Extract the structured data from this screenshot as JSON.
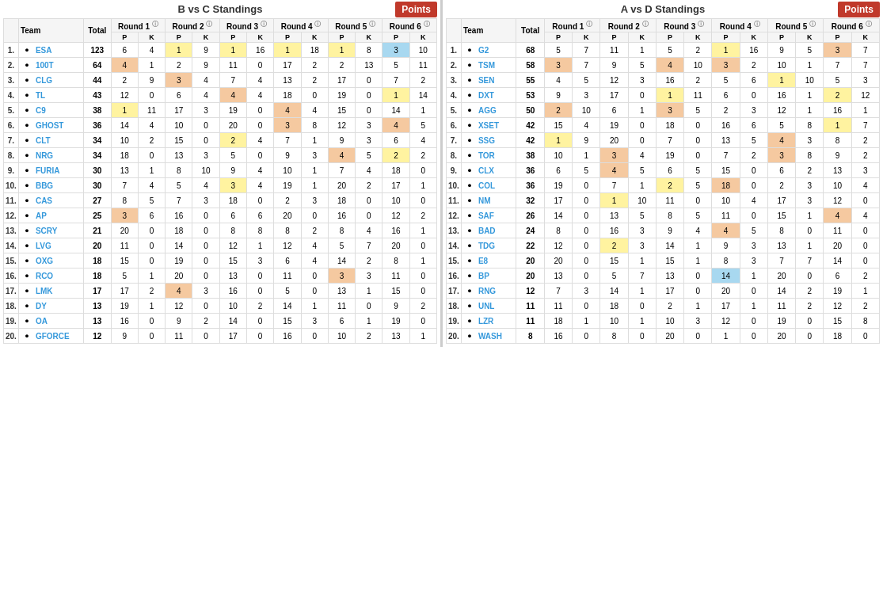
{
  "leftPanel": {
    "title": "B vs C Standings",
    "pointsButton": "Points",
    "columns": [
      "Team",
      "Total",
      "Round 1",
      "Round 2",
      "Round 3",
      "Round 4",
      "Round 5",
      "Round 6"
    ],
    "subCols": [
      "P",
      "K"
    ],
    "teams": [
      {
        "rank": 1,
        "icon": "ESA",
        "name": "ESA",
        "total": 123,
        "r1p": 6,
        "r1k": 4,
        "r2p": 1,
        "r2k": 9,
        "r3p": 1,
        "r3k": 16,
        "r4p": 1,
        "r4k": 18,
        "r5p": 1,
        "r5k": 8,
        "r6p": 3,
        "r6k": 10,
        "r2ph": true,
        "r3ph": true,
        "r4ph": true,
        "r5ph": true,
        "r6bh": true
      },
      {
        "rank": 2,
        "icon": "100T",
        "name": "100T",
        "total": 64,
        "r1p": 4,
        "r1k": 1,
        "r2p": 2,
        "r2k": 9,
        "r3p": 11,
        "r3k": 0,
        "r4p": 17,
        "r4k": 2,
        "r5p": 2,
        "r5k": 13,
        "r6p": 5,
        "r6k": 11,
        "r1oh": true
      },
      {
        "rank": 3,
        "icon": "CLG",
        "name": "CLG",
        "total": 44,
        "r1p": 2,
        "r1k": 9,
        "r2p": 3,
        "r2k": 4,
        "r3p": 7,
        "r3k": 4,
        "r4p": 13,
        "r4k": 2,
        "r5p": 17,
        "r5k": 0,
        "r6p": 7,
        "r6k": 2,
        "r2oh": true
      },
      {
        "rank": 4,
        "icon": "TL",
        "name": "TL",
        "total": 43,
        "r1p": 12,
        "r1k": 0,
        "r2p": 6,
        "r2k": 4,
        "r3p": 4,
        "r3k": 4,
        "r4p": 18,
        "r4k": 0,
        "r5p": 19,
        "r5k": 0,
        "r6p": 1,
        "r6k": 14,
        "r3oh": true,
        "r6ph": true
      },
      {
        "rank": 5,
        "icon": "C9",
        "name": "C9",
        "total": 38,
        "r1p": 1,
        "r1k": 11,
        "r2p": 17,
        "r2k": 3,
        "r3p": 19,
        "r3k": 0,
        "r4p": 4,
        "r4k": 4,
        "r5p": 15,
        "r5k": 0,
        "r6p": 14,
        "r6k": 1,
        "r1ph": true,
        "r4oh": true
      },
      {
        "rank": 6,
        "icon": "GHOST",
        "name": "GHOST",
        "total": 36,
        "r1p": 14,
        "r1k": 4,
        "r2p": 10,
        "r2k": 0,
        "r3p": 20,
        "r3k": 0,
        "r4p": 3,
        "r4k": 8,
        "r5p": 12,
        "r5k": 3,
        "r6p": 4,
        "r6k": 5,
        "r4oh": true,
        "r6oh": true
      },
      {
        "rank": 7,
        "icon": "CLT",
        "name": "CLT",
        "total": 34,
        "r1p": 10,
        "r1k": 2,
        "r2p": 15,
        "r2k": 0,
        "r3p": 2,
        "r3k": 4,
        "r4p": 7,
        "r4k": 1,
        "r5p": 9,
        "r5k": 3,
        "r6p": 6,
        "r6k": 4,
        "r3ph": true
      },
      {
        "rank": 8,
        "icon": "NRG",
        "name": "NRG",
        "total": 34,
        "r1p": 18,
        "r1k": 0,
        "r2p": 13,
        "r2k": 3,
        "r3p": 5,
        "r3k": 0,
        "r4p": 9,
        "r4k": 3,
        "r5p": 4,
        "r5k": 5,
        "r6p": 2,
        "r6k": 2,
        "r5oh": true,
        "r6ph": true
      },
      {
        "rank": 9,
        "icon": "FURIA",
        "name": "FURIA",
        "total": 30,
        "r1p": 13,
        "r1k": 1,
        "r2p": 8,
        "r2k": 10,
        "r3p": 9,
        "r3k": 4,
        "r4p": 10,
        "r4k": 1,
        "r5p": 7,
        "r5k": 4,
        "r6p": 18,
        "r6k": 0
      },
      {
        "rank": 10,
        "icon": "BBG",
        "name": "BBG",
        "total": 30,
        "r1p": 7,
        "r1k": 4,
        "r2p": 5,
        "r2k": 4,
        "r3p": 3,
        "r3k": 4,
        "r4p": 19,
        "r4k": 1,
        "r5p": 20,
        "r5k": 2,
        "r6p": 17,
        "r6k": 1,
        "r3ph": true
      },
      {
        "rank": 11,
        "icon": "CAS",
        "name": "CAS",
        "total": 27,
        "r1p": 8,
        "r1k": 5,
        "r2p": 7,
        "r2k": 3,
        "r3p": 18,
        "r3k": 0,
        "r4p": 2,
        "r4k": 3,
        "r5p": 18,
        "r5k": 0,
        "r6p": 10,
        "r6k": 0
      },
      {
        "rank": 12,
        "icon": "AP",
        "name": "AP",
        "total": 25,
        "r1p": 3,
        "r1k": 6,
        "r2p": 16,
        "r2k": 0,
        "r3p": 6,
        "r3k": 6,
        "r4p": 20,
        "r4k": 0,
        "r5p": 16,
        "r5k": 0,
        "r6p": 12,
        "r6k": 2,
        "r1oh": true
      },
      {
        "rank": 13,
        "icon": "SCRY",
        "name": "SCRY",
        "total": 21,
        "r1p": 20,
        "r1k": 0,
        "r2p": 18,
        "r2k": 0,
        "r3p": 8,
        "r3k": 8,
        "r4p": 8,
        "r4k": 2,
        "r5p": 8,
        "r5k": 4,
        "r6p": 16,
        "r6k": 1
      },
      {
        "rank": 14,
        "icon": "LVG",
        "name": "LVG",
        "total": 20,
        "r1p": 11,
        "r1k": 0,
        "r2p": 14,
        "r2k": 0,
        "r3p": 12,
        "r3k": 1,
        "r4p": 12,
        "r4k": 4,
        "r5p": 5,
        "r5k": 7,
        "r6p": 20,
        "r6k": 0
      },
      {
        "rank": 15,
        "icon": "OXG",
        "name": "OXG",
        "total": 18,
        "r1p": 15,
        "r1k": 0,
        "r2p": 19,
        "r2k": 0,
        "r3p": 15,
        "r3k": 3,
        "r4p": 6,
        "r4k": 4,
        "r5p": 14,
        "r5k": 2,
        "r6p": 8,
        "r6k": 1
      },
      {
        "rank": 16,
        "icon": "RCO",
        "name": "RCO",
        "total": 18,
        "r1p": 5,
        "r1k": 1,
        "r2p": 20,
        "r2k": 0,
        "r3p": 13,
        "r3k": 0,
        "r4p": 11,
        "r4k": 0,
        "r5p": 3,
        "r5k": 3,
        "r6p": 11,
        "r6k": 0,
        "r5oh": true
      },
      {
        "rank": 17,
        "icon": "LMK",
        "name": "LMK",
        "total": 17,
        "r1p": 17,
        "r1k": 2,
        "r2p": 4,
        "r2k": 3,
        "r3p": 16,
        "r3k": 0,
        "r4p": 5,
        "r4k": 0,
        "r5p": 13,
        "r5k": 1,
        "r6p": 15,
        "r6k": 0,
        "r2oh": true
      },
      {
        "rank": 18,
        "icon": "DY",
        "name": "DY",
        "total": 13,
        "r1p": 19,
        "r1k": 1,
        "r2p": 12,
        "r2k": 0,
        "r3p": 10,
        "r3k": 2,
        "r4p": 14,
        "r4k": 1,
        "r5p": 11,
        "r5k": 0,
        "r6p": 9,
        "r6k": 2
      },
      {
        "rank": 19,
        "icon": "OA",
        "name": "OA",
        "total": 13,
        "r1p": 16,
        "r1k": 0,
        "r2p": 9,
        "r2k": 2,
        "r3p": 14,
        "r3k": 0,
        "r4p": 15,
        "r4k": 3,
        "r5p": 6,
        "r5k": 1,
        "r6p": 19,
        "r6k": 0
      },
      {
        "rank": 20,
        "icon": "GFORCE",
        "name": "GFORCE",
        "total": 12,
        "r1p": 9,
        "r1k": 0,
        "r2p": 11,
        "r2k": 0,
        "r3p": 17,
        "r3k": 0,
        "r4p": 16,
        "r4k": 0,
        "r5p": 10,
        "r5k": 2,
        "r6p": 13,
        "r6k": 1
      }
    ]
  },
  "rightPanel": {
    "title": "A vs D Standings",
    "pointsButton": "Points",
    "columns": [
      "Team",
      "Total",
      "Round 1",
      "Round 2",
      "Round 3",
      "Round 4",
      "Round 5",
      "Round 6"
    ],
    "subCols": [
      "P",
      "K"
    ],
    "teams": [
      {
        "rank": 1,
        "icon": "G2",
        "name": "G2",
        "total": 68,
        "r1p": 5,
        "r1k": 7,
        "r2p": 11,
        "r2k": 1,
        "r3p": 5,
        "r3k": 2,
        "r4p": 1,
        "r4k": 16,
        "r5p": 9,
        "r5k": 5,
        "r6p": 3,
        "r6k": 7,
        "r4ph": true,
        "r6oh": true
      },
      {
        "rank": 2,
        "icon": "TSM",
        "name": "TSM",
        "total": 58,
        "r1p": 3,
        "r1k": 7,
        "r2p": 9,
        "r2k": 5,
        "r3p": 4,
        "r3k": 10,
        "r4p": 3,
        "r4k": 2,
        "r5p": 10,
        "r5k": 1,
        "r6p": 7,
        "r6k": 7,
        "r1oh": true,
        "r3oh": true,
        "r4oh": true
      },
      {
        "rank": 3,
        "icon": "SEN",
        "name": "SEN",
        "total": 55,
        "r1p": 4,
        "r1k": 5,
        "r2p": 12,
        "r2k": 3,
        "r3p": 16,
        "r3k": 2,
        "r4p": 5,
        "r4k": 6,
        "r5p": 1,
        "r5k": 10,
        "r6p": 5,
        "r6k": 3,
        "r5ph": true
      },
      {
        "rank": 4,
        "icon": "DXT",
        "name": "DXT",
        "total": 53,
        "r1p": 9,
        "r1k": 3,
        "r2p": 17,
        "r2k": 0,
        "r3p": 1,
        "r3k": 11,
        "r4p": 6,
        "r4k": 0,
        "r5p": 16,
        "r5k": 1,
        "r6p": 2,
        "r6k": 12,
        "r3ph": true,
        "r6ph": true
      },
      {
        "rank": 5,
        "icon": "AGG",
        "name": "AGG",
        "total": 50,
        "r1p": 2,
        "r1k": 10,
        "r2p": 6,
        "r2k": 1,
        "r3p": 3,
        "r3k": 5,
        "r4p": 2,
        "r4k": 3,
        "r5p": 12,
        "r5k": 1,
        "r6p": 16,
        "r6k": 1,
        "r1oh": true,
        "r3oh": true
      },
      {
        "rank": 6,
        "icon": "XSET",
        "name": "XSET",
        "total": 42,
        "r1p": 15,
        "r1k": 4,
        "r2p": 19,
        "r2k": 0,
        "r3p": 18,
        "r3k": 0,
        "r4p": 16,
        "r4k": 6,
        "r5p": 5,
        "r5k": 8,
        "r6p": 1,
        "r6k": 7,
        "r6ph": true
      },
      {
        "rank": 7,
        "icon": "SSG",
        "name": "SSG",
        "total": 42,
        "r1p": 1,
        "r1k": 9,
        "r2p": 20,
        "r2k": 0,
        "r3p": 7,
        "r3k": 0,
        "r4p": 13,
        "r4k": 5,
        "r5p": 4,
        "r5k": 3,
        "r6p": 8,
        "r6k": 2,
        "r1ph": true,
        "r5oh": true
      },
      {
        "rank": 8,
        "icon": "TOR",
        "name": "TOR",
        "total": 38,
        "r1p": 10,
        "r1k": 1,
        "r2p": 3,
        "r2k": 4,
        "r3p": 19,
        "r3k": 0,
        "r4p": 7,
        "r4k": 2,
        "r5p": 3,
        "r5k": 8,
        "r6p": 9,
        "r6k": 2,
        "r2oh": true,
        "r5oh": true
      },
      {
        "rank": 9,
        "icon": "CLX",
        "name": "CLX",
        "total": 36,
        "r1p": 6,
        "r1k": 5,
        "r2p": 4,
        "r2k": 5,
        "r3p": 6,
        "r3k": 5,
        "r4p": 15,
        "r4k": 0,
        "r5p": 6,
        "r5k": 2,
        "r6p": 13,
        "r6k": 3,
        "r2oh": true
      },
      {
        "rank": 10,
        "icon": "COL",
        "name": "COL",
        "total": 36,
        "r1p": 19,
        "r1k": 0,
        "r2p": 7,
        "r2k": 1,
        "r3p": 2,
        "r3k": 5,
        "r4p": 18,
        "r4k": 0,
        "r5p": 2,
        "r5k": 3,
        "r6p": 10,
        "r6k": 4,
        "r3ph": true,
        "r4oh": true
      },
      {
        "rank": 11,
        "icon": "NM",
        "name": "NM",
        "total": 32,
        "r1p": 17,
        "r1k": 0,
        "r2p": 1,
        "r2k": 10,
        "r3p": 11,
        "r3k": 0,
        "r4p": 10,
        "r4k": 4,
        "r5p": 17,
        "r5k": 3,
        "r6p": 12,
        "r6k": 0,
        "r2ph": true
      },
      {
        "rank": 12,
        "icon": "SAF",
        "name": "SAF",
        "total": 26,
        "r1p": 14,
        "r1k": 0,
        "r2p": 13,
        "r2k": 5,
        "r3p": 8,
        "r3k": 5,
        "r4p": 11,
        "r4k": 0,
        "r5p": 15,
        "r5k": 1,
        "r6p": 4,
        "r6k": 4,
        "r6oh": true
      },
      {
        "rank": 13,
        "icon": "BAD",
        "name": "BAD",
        "total": 24,
        "r1p": 8,
        "r1k": 0,
        "r2p": 16,
        "r2k": 3,
        "r3p": 9,
        "r3k": 4,
        "r4p": 4,
        "r4k": 5,
        "r5p": 8,
        "r5k": 0,
        "r6p": 11,
        "r6k": 0,
        "r4oh": true
      },
      {
        "rank": 14,
        "icon": "TDG",
        "name": "TDG",
        "total": 22,
        "r1p": 12,
        "r1k": 0,
        "r2p": 2,
        "r2k": 3,
        "r3p": 14,
        "r3k": 1,
        "r4p": 9,
        "r4k": 3,
        "r5p": 13,
        "r5k": 1,
        "r6p": 20,
        "r6k": 0,
        "r2ph": true
      },
      {
        "rank": 15,
        "icon": "E8",
        "name": "E8",
        "total": 20,
        "r1p": 20,
        "r1k": 0,
        "r2p": 15,
        "r2k": 1,
        "r3p": 15,
        "r3k": 1,
        "r4p": 8,
        "r4k": 3,
        "r5p": 7,
        "r5k": 7,
        "r6p": 14,
        "r6k": 0
      },
      {
        "rank": 16,
        "icon": "BP",
        "name": "BP",
        "total": 20,
        "r1p": 13,
        "r1k": 0,
        "r2p": 5,
        "r2k": 7,
        "r3p": 13,
        "r3k": 0,
        "r4p": 14,
        "r4k": 1,
        "r5p": 20,
        "r5k": 0,
        "r6p": 6,
        "r6k": 2,
        "r4bh": true
      },
      {
        "rank": 17,
        "icon": "RNG",
        "name": "RNG",
        "total": 12,
        "r1p": 7,
        "r1k": 3,
        "r2p": 14,
        "r2k": 1,
        "r3p": 17,
        "r3k": 0,
        "r4p": 20,
        "r4k": 0,
        "r5p": 14,
        "r5k": 2,
        "r6p": 19,
        "r6k": 1
      },
      {
        "rank": 18,
        "icon": "UNL",
        "name": "UNL",
        "total": 11,
        "r1p": 11,
        "r1k": 0,
        "r2p": 18,
        "r2k": 0,
        "r3p": 2,
        "r3k": 1,
        "r4p": 17,
        "r4k": 1,
        "r5p": 11,
        "r5k": 2,
        "r6p": 12,
        "r6k": 2
      },
      {
        "rank": 19,
        "icon": "LZR",
        "name": "LZR",
        "total": 11,
        "r1p": 18,
        "r1k": 1,
        "r2p": 10,
        "r2k": 1,
        "r3p": 10,
        "r3k": 3,
        "r4p": 12,
        "r4k": 0,
        "r5p": 19,
        "r5k": 0,
        "r6p": 15,
        "r6k": 8
      },
      {
        "rank": 20,
        "icon": "WASH",
        "name": "WASH",
        "total": 8,
        "r1p": 16,
        "r1k": 0,
        "r2p": 8,
        "r2k": 0,
        "r3p": 20,
        "r3k": 0,
        "r4p": 1,
        "r4k": 0,
        "r5p": 20,
        "r5k": 0,
        "r6p": 18,
        "r6k": 0
      }
    ]
  }
}
